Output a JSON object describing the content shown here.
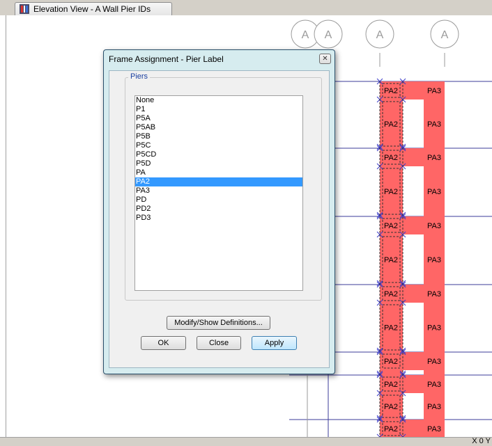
{
  "document_tab": {
    "title": "Elevation View - A  Wall Pier IDs"
  },
  "grid_bubbles": [
    {
      "label": "A"
    },
    {
      "label": "A"
    },
    {
      "label": "A"
    },
    {
      "label": "A"
    }
  ],
  "piers": {
    "left_label": "PA2",
    "right_label": "PA3",
    "fill_color": "#ff6666",
    "line_color": "#3b3b9a",
    "marker_color": "#3b3bc8"
  },
  "dialog": {
    "title": "Frame Assignment - Pier Label",
    "close_label": "✕",
    "group_label": "Piers",
    "items": [
      "None",
      "P1",
      "P5A",
      "P5AB",
      "P5B",
      "P5C",
      "P5CD",
      "P5D",
      "PA",
      "PA2",
      "PA3",
      "PD",
      "PD2",
      "PD3"
    ],
    "selected_index": 9,
    "modify_label": "Modify/Show Definitions...",
    "ok_label": "OK",
    "close_button_label": "Close",
    "apply_label": "Apply"
  },
  "status_bar": {
    "coords": "X 0  Y"
  }
}
